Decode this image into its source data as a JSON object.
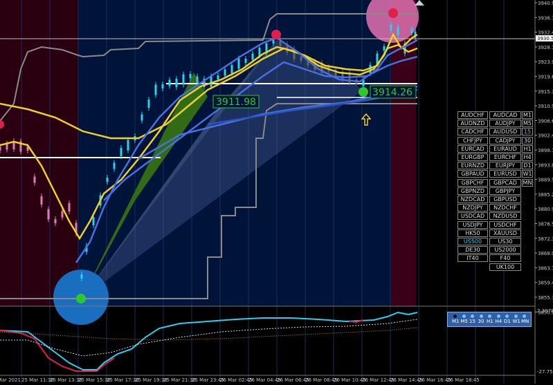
{
  "chart": {
    "price_labels": [
      "3940.90",
      "3936.70",
      "3932.40",
      "3928.10",
      "3923.90",
      "3919.60",
      "3915.30",
      "3910.90",
      "3906.60",
      "3902.40",
      "3898.10",
      "3893.80",
      "3889.50",
      "3885.20",
      "3880.90",
      "3876.50",
      "3872.30",
      "3868.00",
      "3863.70",
      "3859.40",
      "3855.10",
      "3850.90"
    ],
    "current_price": "3930.50",
    "time_labels": [
      "2 Mar 2021",
      "25 Mar 11:30",
      "25 Mar 13:30",
      "25 Mar 15:30",
      "25 Mar 17:30",
      "25 Mar 19:30",
      "25 Mar 21:30",
      "25 Mar 23:45",
      "26 Mar 02:45",
      "26 Mar 04:45",
      "26 Mar 06:45",
      "26 Mar 08:45",
      "26 Mar 10:45",
      "26 Mar 12:45",
      "26 Mar 14:45",
      "26 Mar 16:45",
      "26 Mar 18:45"
    ],
    "annotations": {
      "level_left": "3911.98",
      "level_right": "3914.26"
    },
    "osc_labels": {
      "top": "2.3978",
      "bottom": "-27.7546"
    }
  },
  "symbols": [
    [
      "AUDCHF",
      "AUDCAD",
      "M1"
    ],
    [
      "AUDNZD",
      "AUDJPY",
      "M5"
    ],
    [
      "CADCHF",
      "AUDUSD",
      "15"
    ],
    [
      "CHFJPY",
      "CADJPY",
      "30"
    ],
    [
      "EURCAD",
      "EURAUD",
      "H1"
    ],
    [
      "EURGBP",
      "EURCHF",
      "H4"
    ],
    [
      "EURNZD",
      "EURJPY",
      "D1"
    ],
    [
      "GBPAUD",
      "EURUSD",
      "W1"
    ],
    [
      "GBPCHF",
      "GBPCAD",
      "MN"
    ],
    [
      "GBPNZD",
      "GBPJPY",
      ""
    ],
    [
      "NZDCAD",
      "GBPUSD",
      ""
    ],
    [
      "NZDJPY",
      "NZDCHF",
      ""
    ],
    [
      "USDCAD",
      "NZDUSD",
      ""
    ],
    [
      "USDJPY",
      "USDCHF",
      ""
    ],
    [
      "HK50",
      "XAUUSD",
      ""
    ],
    [
      "US500",
      "US30",
      ""
    ],
    [
      "DE30",
      "US2000",
      ""
    ],
    [
      "IT40",
      "F40",
      ""
    ],
    [
      "",
      "UK100",
      ""
    ]
  ],
  "active_symbol": "US500",
  "active_timeframe": "15",
  "tf_strip": [
    "M1",
    "M5",
    "15",
    "30",
    "H1",
    "H4",
    "D1",
    "W1",
    "MN"
  ],
  "colors": {
    "bg_left": "#2a0010",
    "bg_mid": "#00143a",
    "bg_right": "#3a0018",
    "cyan": "#29d0f0",
    "pink": "#e07ab8",
    "yellow": "#f0d020",
    "blue": "#4a6fe0",
    "grey": "#8a8a8a",
    "green": "#2ec82e",
    "red": "#e0204a"
  }
}
